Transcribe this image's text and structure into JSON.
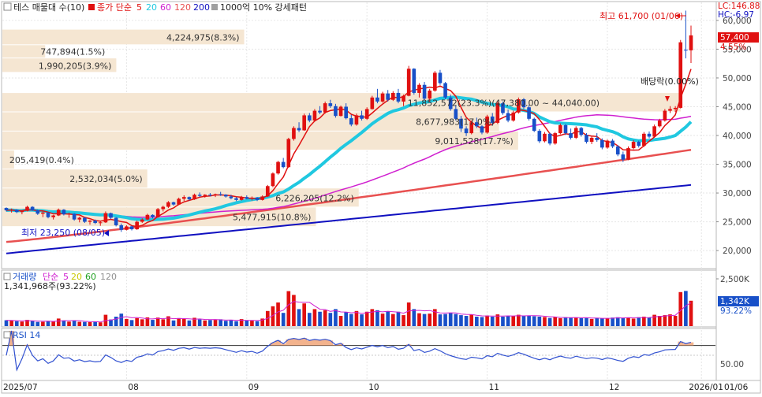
{
  "header": {
    "icon": "checkbox-icon",
    "title": "테스 매물대 수(10)",
    "legend": [
      {
        "text": "종가 단순",
        "color": "#e01010"
      },
      {
        "text": "5",
        "color": "#e01010"
      },
      {
        "text": "20",
        "color": "#20c8e0"
      },
      {
        "text": "60",
        "color": "#d020d0"
      },
      {
        "text": "120",
        "color": "#e85050"
      },
      {
        "text": "200",
        "color": "#1010c0"
      }
    ],
    "pattern_label": "1000억 10% 강세패턴"
  },
  "indicator_readouts": {
    "lc": "LC:146.88",
    "hc": "HC:-6.97"
  },
  "current_price": {
    "value": "57,400",
    "change": "4.55%"
  },
  "high_low": {
    "high": "최고 61,700 (01/06)",
    "low": "최저 23,250 (08/05)"
  },
  "dividend_label": "배당락(0.00%)",
  "volume_profile": [
    {
      "label": "4,224,975(8.3%)"
    },
    {
      "label": "747,894(1.5%)"
    },
    {
      "label": "1,990,205(3.9%)"
    },
    {
      "label": "11,852,572(23.3%)(47,380.00 ~ 44,040.00)"
    },
    {
      "label": "8,677,983(17.0%)"
    },
    {
      "label": "9,011,528(17.7%)"
    },
    {
      "label": "205,419(0.4%)"
    },
    {
      "label": "2,532,034(5.0%)"
    },
    {
      "label": "6,226,205(12.2%)"
    },
    {
      "label": "5,477,915(10.8%)"
    }
  ],
  "volume_panel": {
    "title": "거래량",
    "legend": [
      {
        "text": "단순",
        "color": "#d020d0"
      },
      {
        "text": "5",
        "color": "#d020d0"
      },
      {
        "text": "20",
        "color": "#c8c800"
      },
      {
        "text": "60",
        "color": "#20a020"
      },
      {
        "text": "120",
        "color": "#909090"
      }
    ],
    "readout": "1,341,968주(93.22%)",
    "current": {
      "value": "1,342K",
      "pct": "93.22%"
    },
    "tick": "2,500K"
  },
  "rsi_panel": {
    "title": "RSI 14",
    "tick": "50.00"
  },
  "price_axis_ticks": [
    "60,000",
    "55,000",
    "50,000",
    "45,000",
    "40,000",
    "35,000",
    "30,000",
    "25,000",
    "20,000"
  ],
  "date_axis_ticks": [
    "2025/07",
    "08",
    "09",
    "10",
    "11",
    "12",
    "2026/01"
  ],
  "date_corner": "01/06",
  "colors": {
    "up": "#e01010",
    "down": "#1850c8",
    "profile": "#f5e6d2"
  },
  "chart_data": {
    "type": "candlestick",
    "price_axis": {
      "min": 17000,
      "max": 63000,
      "ticks": [
        20000,
        25000,
        30000,
        35000,
        40000,
        45000,
        50000,
        55000,
        60000
      ]
    },
    "volume_profile": [
      {
        "price_low": 55700,
        "price_high": 58400,
        "volume": 4224975
      },
      {
        "price_low": 53400,
        "price_high": 55700,
        "volume": 747894
      },
      {
        "price_low": 50900,
        "price_high": 53400,
        "volume": 1990205
      },
      {
        "price_low": 44040,
        "price_high": 47380,
        "volume": 11852572
      },
      {
        "price_low": 40700,
        "price_high": 44040,
        "volume": 8677983
      },
      {
        "price_low": 37400,
        "price_high": 40700,
        "volume": 9011528
      },
      {
        "price_low": 34100,
        "price_high": 37400,
        "volume": 205419
      },
      {
        "price_low": 30800,
        "price_high": 34100,
        "volume": 2532034
      },
      {
        "price_low": 27500,
        "price_high": 30800,
        "volume": 6226205
      },
      {
        "price_low": 24100,
        "price_high": 27500,
        "volume": 5477915
      }
    ],
    "candles": [
      [
        27400,
        27500,
        26800,
        27000
      ],
      [
        27000,
        27300,
        26600,
        27100
      ],
      [
        27100,
        27200,
        26500,
        26700
      ],
      [
        26700,
        27000,
        26300,
        26900
      ],
      [
        26900,
        27800,
        26800,
        27600
      ],
      [
        27600,
        27700,
        26900,
        27000
      ],
      [
        27000,
        27100,
        26200,
        26400
      ],
      [
        26400,
        26800,
        25800,
        26600
      ],
      [
        26600,
        26700,
        25600,
        25800
      ],
      [
        25800,
        26200,
        25400,
        26100
      ],
      [
        26100,
        27300,
        26000,
        27100
      ],
      [
        27100,
        27200,
        26100,
        26300
      ],
      [
        26300,
        26600,
        25700,
        26400
      ],
      [
        26400,
        26500,
        25200,
        25400
      ],
      [
        25400,
        25900,
        24900,
        25700
      ],
      [
        25700,
        25800,
        24800,
        25000
      ],
      [
        25000,
        25300,
        24500,
        25200
      ],
      [
        25200,
        25400,
        24600,
        24800
      ],
      [
        24800,
        25100,
        24300,
        24900
      ],
      [
        24900,
        26800,
        24800,
        26500
      ],
      [
        26500,
        26600,
        25500,
        25700
      ],
      [
        25700,
        25800,
        24200,
        24400
      ],
      [
        24400,
        24700,
        23250,
        23600
      ],
      [
        23600,
        24400,
        23500,
        24200
      ],
      [
        24200,
        24300,
        23500,
        23700
      ],
      [
        23700,
        25200,
        23600,
        25000
      ],
      [
        25000,
        25600,
        24800,
        25400
      ],
      [
        25400,
        26400,
        25300,
        26200
      ],
      [
        26200,
        26300,
        25600,
        25800
      ],
      [
        25800,
        27400,
        25700,
        27200
      ],
      [
        27200,
        27800,
        26800,
        27600
      ],
      [
        27600,
        28600,
        27400,
        28400
      ],
      [
        28400,
        28500,
        27800,
        28000
      ],
      [
        28000,
        29200,
        27900,
        29000
      ],
      [
        29000,
        29600,
        28600,
        29300
      ],
      [
        29300,
        29400,
        28700,
        28900
      ],
      [
        28900,
        29900,
        28800,
        29700
      ],
      [
        29700,
        30100,
        29300,
        29500
      ],
      [
        29500,
        29800,
        29200,
        29700
      ],
      [
        29700,
        30000,
        29400,
        29600
      ],
      [
        29600,
        29900,
        29300,
        29800
      ],
      [
        29800,
        30200,
        29500,
        29700
      ],
      [
        29700,
        29800,
        29200,
        29400
      ],
      [
        29400,
        29700,
        28900,
        29100
      ],
      [
        29100,
        29300,
        28600,
        28800
      ],
      [
        28800,
        29500,
        28700,
        29300
      ],
      [
        29300,
        29600,
        28900,
        29000
      ],
      [
        29000,
        29400,
        28700,
        29200
      ],
      [
        29200,
        29300,
        28600,
        28800
      ],
      [
        28800,
        29600,
        28700,
        29400
      ],
      [
        29400,
        31400,
        29300,
        31200
      ],
      [
        31200,
        33600,
        31000,
        33400
      ],
      [
        33400,
        35600,
        33200,
        35400
      ],
      [
        35400,
        36100,
        34300,
        34500
      ],
      [
        34500,
        39600,
        34400,
        39400
      ],
      [
        39400,
        41600,
        39100,
        41300
      ],
      [
        41300,
        42300,
        40600,
        40900
      ],
      [
        40900,
        43800,
        40800,
        43500
      ],
      [
        43500,
        43900,
        42300,
        42600
      ],
      [
        42600,
        44600,
        42400,
        44300
      ],
      [
        44300,
        45100,
        43700,
        44000
      ],
      [
        44000,
        45900,
        43800,
        45600
      ],
      [
        45600,
        46200,
        44800,
        45100
      ],
      [
        45100,
        45500,
        43100,
        43400
      ],
      [
        43400,
        45200,
        43300,
        45000
      ],
      [
        45000,
        45600,
        42800,
        43000
      ],
      [
        43000,
        43600,
        41600,
        41900
      ],
      [
        41900,
        43800,
        41700,
        43500
      ],
      [
        43500,
        44300,
        42600,
        42900
      ],
      [
        42900,
        44900,
        42700,
        44600
      ],
      [
        44600,
        46900,
        44500,
        46600
      ],
      [
        46600,
        48100,
        45600,
        45900
      ],
      [
        45900,
        47600,
        45700,
        47300
      ],
      [
        47300,
        47900,
        45900,
        46200
      ],
      [
        46200,
        47700,
        46000,
        47400
      ],
      [
        47400,
        48100,
        45600,
        45900
      ],
      [
        45900,
        47100,
        45100,
        46900
      ],
      [
        46900,
        52100,
        46800,
        51600
      ],
      [
        51600,
        51700,
        47100,
        47400
      ],
      [
        47400,
        49100,
        46600,
        48800
      ],
      [
        48800,
        49300,
        46100,
        46400
      ],
      [
        46400,
        48100,
        45800,
        47800
      ],
      [
        47800,
        51200,
        47600,
        50900
      ],
      [
        50900,
        51400,
        48800,
        49100
      ],
      [
        49100,
        49300,
        46300,
        46600
      ],
      [
        46600,
        47100,
        44300,
        44600
      ],
      [
        44600,
        45300,
        42600,
        42900
      ],
      [
        42900,
        43400,
        40600,
        41200
      ],
      [
        41200,
        41600,
        39900,
        40400
      ],
      [
        40400,
        42600,
        40200,
        42300
      ],
      [
        42300,
        43100,
        41300,
        41600
      ],
      [
        41600,
        41800,
        40200,
        40500
      ],
      [
        40500,
        43600,
        40300,
        43300
      ],
      [
        43300,
        43900,
        41900,
        42200
      ],
      [
        42200,
        45900,
        42000,
        45600
      ],
      [
        45600,
        45900,
        43600,
        43900
      ],
      [
        43900,
        44500,
        42300,
        42600
      ],
      [
        42600,
        44300,
        42400,
        44000
      ],
      [
        44000,
        46600,
        43800,
        46300
      ],
      [
        46300,
        46500,
        44600,
        44900
      ],
      [
        44900,
        45300,
        42600,
        42900
      ],
      [
        42900,
        43100,
        40600,
        40800
      ],
      [
        40800,
        41100,
        38700,
        39000
      ],
      [
        39000,
        40600,
        38800,
        40300
      ],
      [
        40300,
        40500,
        38300,
        38600
      ],
      [
        38600,
        40600,
        38400,
        40400
      ],
      [
        40400,
        42100,
        40200,
        41800
      ],
      [
        41800,
        42000,
        40100,
        40400
      ],
      [
        40400,
        41200,
        39300,
        39600
      ],
      [
        39600,
        41600,
        39400,
        41300
      ],
      [
        41300,
        41500,
        39800,
        40100
      ],
      [
        40100,
        40400,
        38600,
        38900
      ],
      [
        38900,
        39800,
        38500,
        39600
      ],
      [
        39600,
        40400,
        38900,
        39200
      ],
      [
        39200,
        39500,
        37600,
        37900
      ],
      [
        37900,
        39300,
        37700,
        39100
      ],
      [
        39100,
        39400,
        37800,
        38100
      ],
      [
        38100,
        38300,
        36400,
        36700
      ],
      [
        36700,
        37200,
        35400,
        35800
      ],
      [
        35800,
        38100,
        35700,
        37800
      ],
      [
        37800,
        39200,
        37600,
        38900
      ],
      [
        38900,
        39100,
        37900,
        38200
      ],
      [
        38200,
        40600,
        38000,
        40300
      ],
      [
        40300,
        40700,
        39500,
        39800
      ],
      [
        39800,
        41900,
        39600,
        41600
      ],
      [
        41600,
        42900,
        41400,
        42600
      ],
      [
        42600,
        44600,
        42400,
        44300
      ],
      [
        44300,
        45100,
        43900,
        44600
      ],
      [
        44600,
        45100,
        44100,
        44800
      ],
      [
        44800,
        56600,
        44700,
        56200
      ],
      [
        54900,
        61700,
        53400,
        54800
      ],
      [
        54800,
        59100,
        52600,
        57400
      ]
    ],
    "volume_k": [
      310,
      290,
      260,
      240,
      330,
      280,
      220,
      230,
      270,
      240,
      400,
      300,
      240,
      280,
      230,
      220,
      210,
      230,
      200,
      600,
      350,
      500,
      660,
      380,
      320,
      420,
      360,
      460,
      330,
      450,
      360,
      520,
      300,
      420,
      380,
      300,
      440,
      350,
      300,
      320,
      330,
      360,
      280,
      310,
      260,
      370,
      300,
      290,
      260,
      400,
      800,
      1050,
      1250,
      700,
      1850,
      1650,
      900,
      1200,
      700,
      900,
      760,
      840,
      700,
      900,
      540,
      740,
      640,
      800,
      620,
      760,
      900,
      840,
      660,
      780,
      640,
      760,
      580,
      1250,
      900,
      680,
      640,
      660,
      900,
      620,
      640,
      700,
      640,
      580,
      540,
      600,
      500,
      480,
      560,
      500,
      620,
      500,
      520,
      540,
      600,
      540,
      560,
      520,
      500,
      480,
      430,
      480,
      420,
      470,
      440,
      460,
      420,
      430,
      380,
      440,
      400,
      420,
      450,
      470,
      430,
      450,
      400,
      470,
      500,
      460,
      600,
      540,
      580,
      620,
      540,
      1800,
      1860,
      1342
    ]
  }
}
